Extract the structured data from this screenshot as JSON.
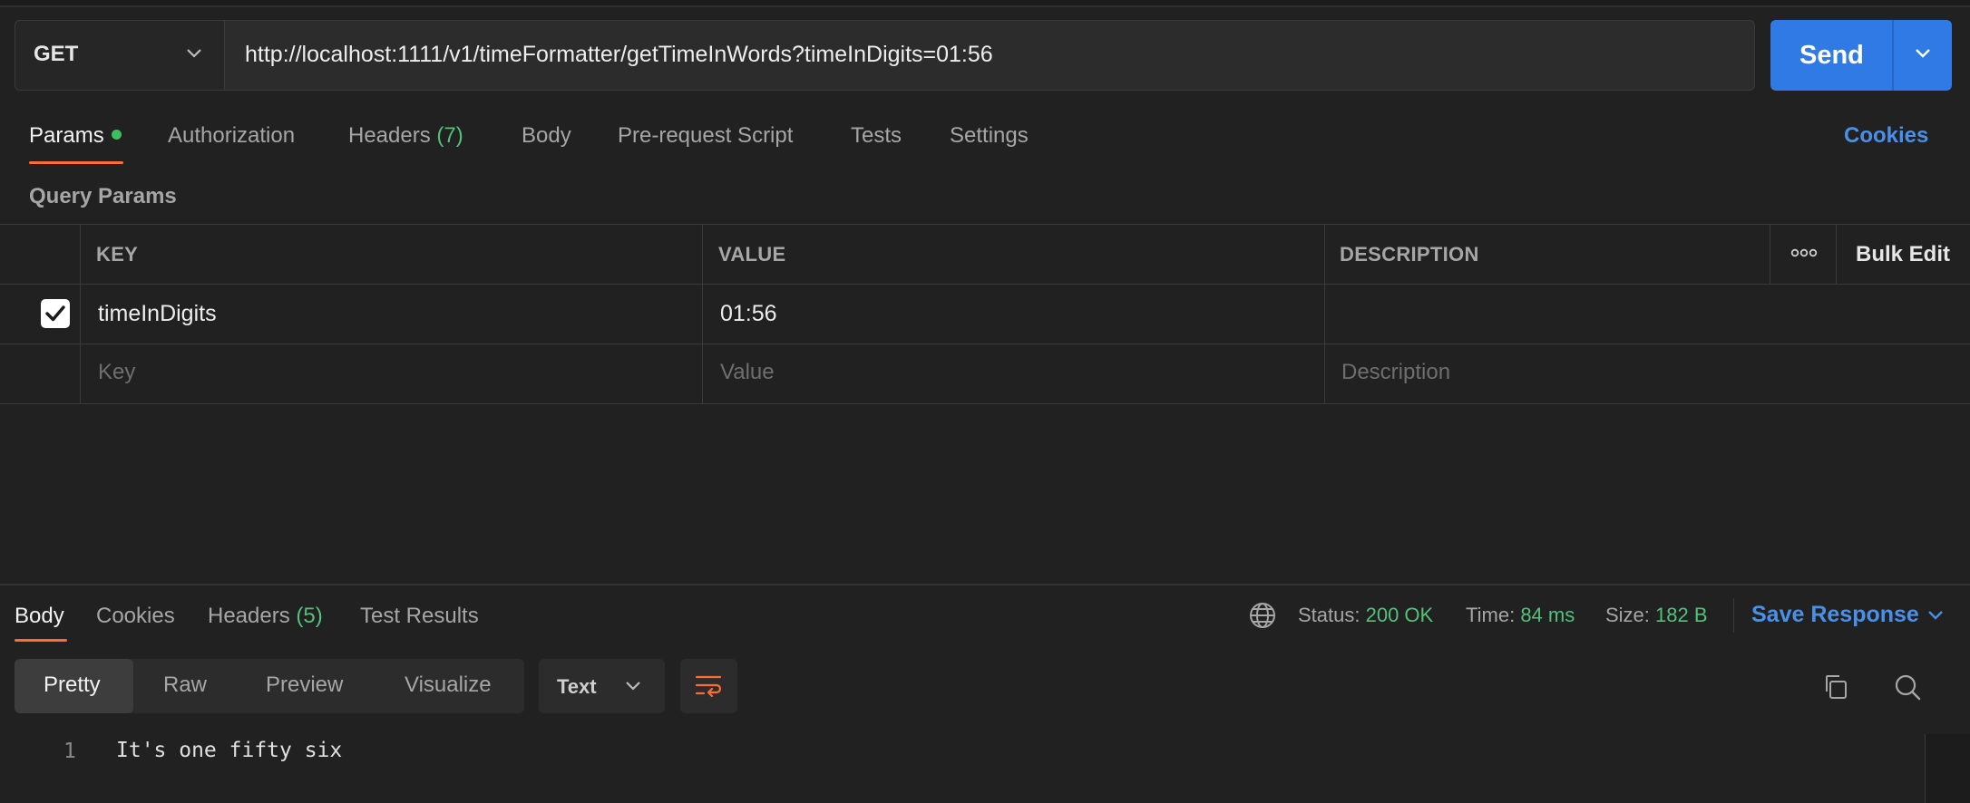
{
  "request": {
    "method": "GET",
    "url": "http://localhost:1111/v1/timeFormatter/getTimeInWords?timeInDigits=01:56",
    "send_label": "Send"
  },
  "request_tabs": {
    "params": "Params",
    "authorization": "Authorization",
    "headers": "Headers",
    "headers_count": "(7)",
    "body": "Body",
    "pre_request": "Pre-request Script",
    "tests": "Tests",
    "settings": "Settings",
    "cookies": "Cookies"
  },
  "query_params": {
    "title": "Query Params",
    "columns": {
      "key": "KEY",
      "value": "VALUE",
      "description": "DESCRIPTION",
      "bulk_edit": "Bulk Edit"
    },
    "rows": [
      {
        "enabled": true,
        "key": "timeInDigits",
        "value": "01:56",
        "description": ""
      }
    ],
    "placeholders": {
      "key": "Key",
      "value": "Value",
      "description": "Description"
    }
  },
  "response_tabs": {
    "body": "Body",
    "cookies": "Cookies",
    "headers": "Headers",
    "headers_count": "(5)",
    "test_results": "Test Results"
  },
  "response_status": {
    "status_label": "Status:",
    "status_value": "200 OK",
    "time_label": "Time:",
    "time_value": "84 ms",
    "size_label": "Size:",
    "size_value": "182 B",
    "save_response": "Save Response"
  },
  "response_view": {
    "modes": [
      "Pretty",
      "Raw",
      "Preview",
      "Visualize"
    ],
    "active_mode": "Pretty",
    "format": "Text"
  },
  "response_body": {
    "lines": [
      {
        "number": "1",
        "text": "It's one fifty six"
      }
    ]
  },
  "colors": {
    "accent": "#ff6c37",
    "send_blue": "#2f7ae5",
    "link_blue": "#4a90e8",
    "success_green": "#52c27a",
    "background": "#212121"
  },
  "icons": [
    "chevron-down-icon",
    "more-horizontal-icon",
    "checkmark-icon",
    "globe-icon",
    "wrap-lines-icon",
    "copy-icon",
    "search-icon"
  ]
}
